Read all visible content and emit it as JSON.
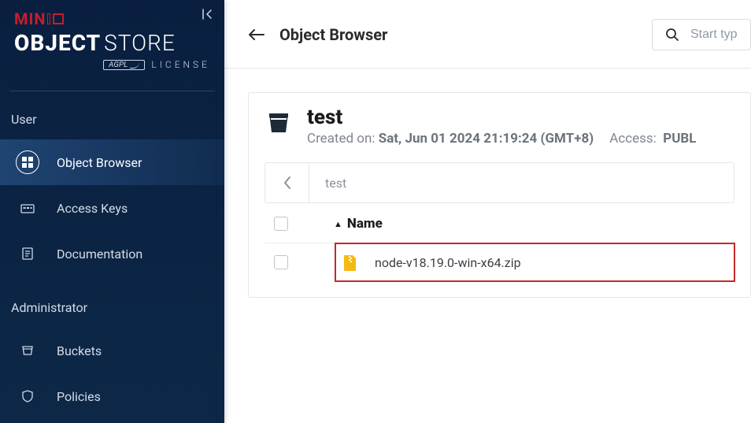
{
  "brand": {
    "minio": "MINIO",
    "object": "OBJECT",
    "store": "STORE",
    "agpl": "AGPL",
    "license": "LICENSE"
  },
  "sidebar": {
    "sections": [
      {
        "label": "User",
        "items": [
          {
            "label": "Object Browser",
            "active": true,
            "icon": "object-browser"
          },
          {
            "label": "Access Keys",
            "active": false,
            "icon": "access-keys"
          },
          {
            "label": "Documentation",
            "active": false,
            "icon": "documentation"
          }
        ]
      },
      {
        "label": "Administrator",
        "items": [
          {
            "label": "Buckets",
            "active": false,
            "icon": "buckets"
          },
          {
            "label": "Policies",
            "active": false,
            "icon": "policies"
          }
        ]
      }
    ]
  },
  "topbar": {
    "title": "Object Browser",
    "search_placeholder": "Start typ"
  },
  "bucket": {
    "name": "test",
    "created_label": "Created on:",
    "created_value": "Sat, Jun 01 2024 21:19:24 (GMT+8)",
    "access_label": "Access:",
    "access_value": "PUBL",
    "breadcrumb": "test"
  },
  "table": {
    "columns": {
      "name": "Name"
    },
    "rows": [
      {
        "filename": "node-v18.19.0-win-x64.zip",
        "highlighted": true
      }
    ]
  }
}
